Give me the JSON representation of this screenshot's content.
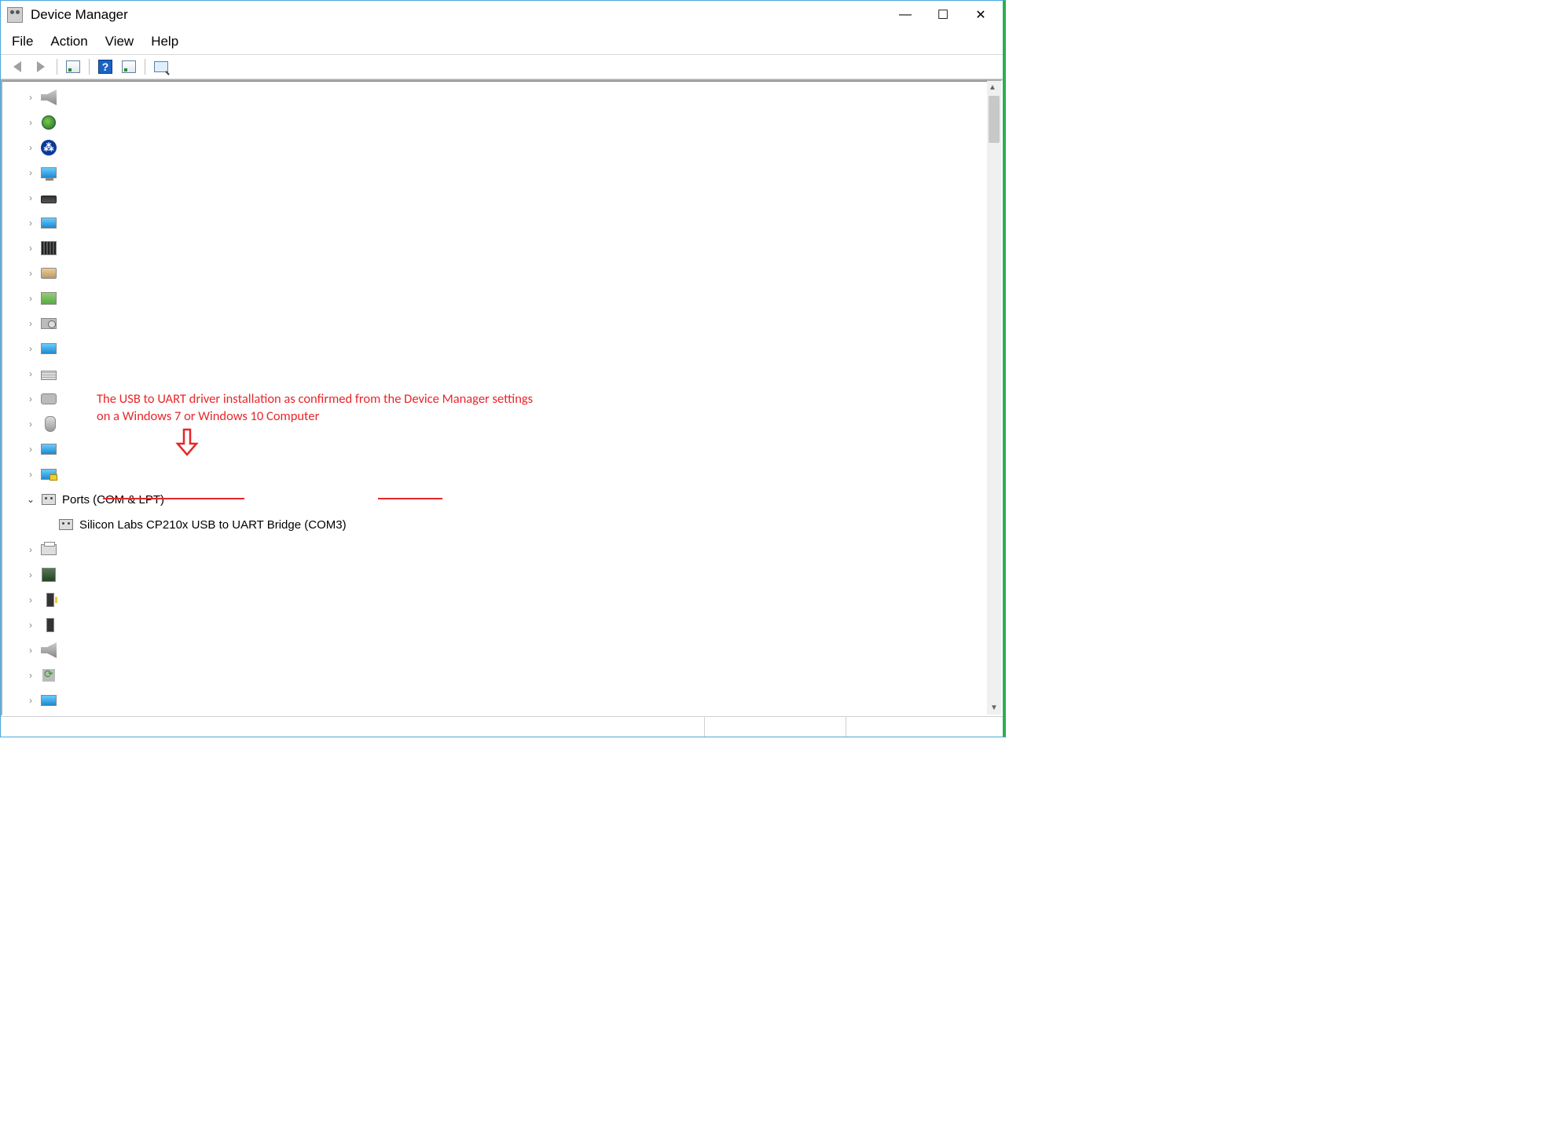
{
  "window": {
    "title": "Device Manager"
  },
  "menu": {
    "file": "File",
    "action": "Action",
    "view": "View",
    "help": "Help"
  },
  "tree": {
    "expanded_category": {
      "label": "Ports (COM & LPT)"
    },
    "expanded_child": {
      "label": "Silicon Labs CP210x USB to UART Bridge (COM3)"
    }
  },
  "annotation": {
    "text": "The USB to UART driver installation as confirmed from the Device Manager settings on a Windows 7 or Windows 10 Computer"
  },
  "collapsed_categories_count": 24
}
